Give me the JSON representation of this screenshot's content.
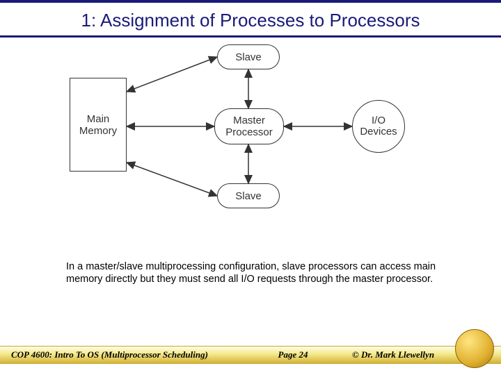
{
  "title": "1: Assignment of Processes to Processors",
  "diagram": {
    "main_memory": "Main\nMemory",
    "slave_top": "Slave",
    "master": "Master\nProcessor",
    "slave_bottom": "Slave",
    "io": "I/O\nDevices"
  },
  "caption": "In a master/slave multiprocessing configuration, slave processors can access main memory directly but they must send all I/O requests through the master  processor.",
  "footer": {
    "course": "COP 4600: Intro To OS  (Multiprocessor Scheduling)",
    "page": "Page 24",
    "author": "© Dr. Mark Llewellyn"
  }
}
